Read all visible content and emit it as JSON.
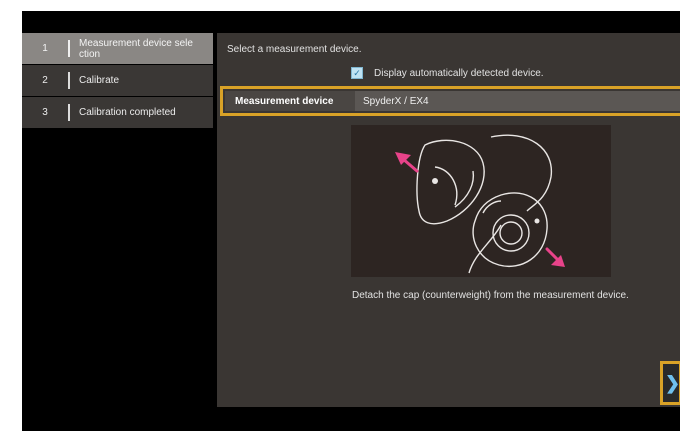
{
  "sidebar": {
    "steps": [
      {
        "num": "1",
        "label": "Measurement device sele ction",
        "active": true
      },
      {
        "num": "2",
        "label": "Calibrate",
        "active": false
      },
      {
        "num": "3",
        "label": "Calibration completed",
        "active": false
      }
    ]
  },
  "main": {
    "prompt": "Select a measurement device.",
    "auto_detect": {
      "label": "Display automatically detected device.",
      "checked": true,
      "check_glyph": "✓"
    },
    "device": {
      "label": "Measurement device",
      "value": "SpyderX / EX4"
    },
    "caption": "Detach the cap (counterweight) from the measurement device.",
    "next_glyph": "❯"
  },
  "colors": {
    "highlight": "#d9a227",
    "arrow": "#e8438a",
    "panel": "#3a3633",
    "active_step": "#8a8784"
  }
}
